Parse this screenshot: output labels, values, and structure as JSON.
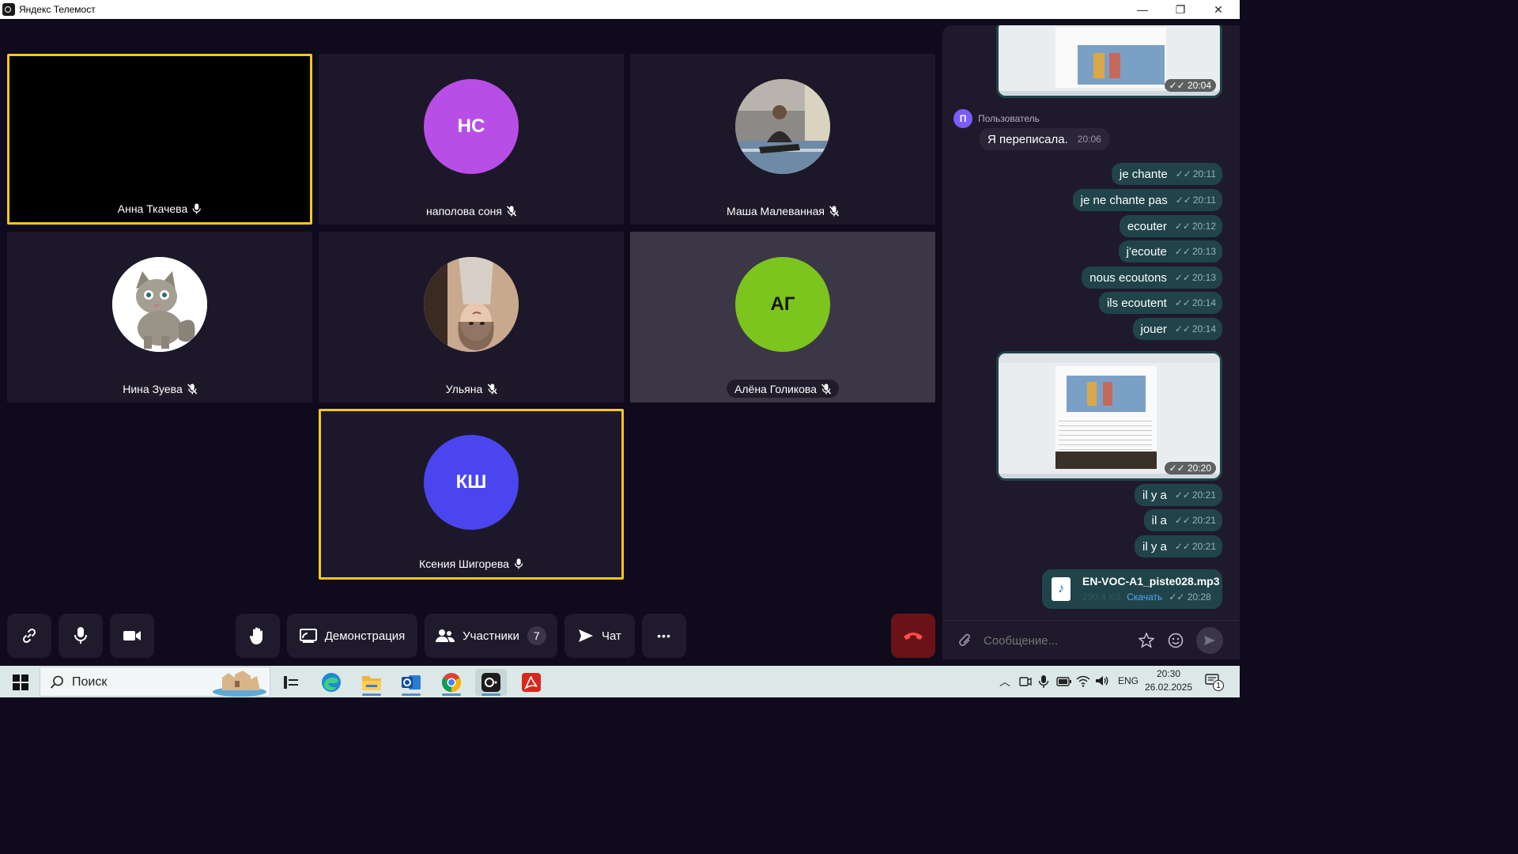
{
  "window": {
    "title": "Яндекс Телемост",
    "controls": {
      "minimize": "—",
      "maximize": "❐",
      "close": "✕"
    }
  },
  "participants": [
    {
      "name": "Анна Ткачева",
      "initials": "",
      "mic": "on",
      "avatar_color": "",
      "style": "black",
      "active": true
    },
    {
      "name": "наполова соня",
      "initials": "НС",
      "mic": "off",
      "avatar_color": "#b94ee6",
      "style": "normal",
      "active": false
    },
    {
      "name": "Маша Малеванная",
      "initials": "",
      "mic": "off",
      "avatar_color": "#8a9bab",
      "style": "normal",
      "active": false,
      "photo": true
    },
    {
      "name": "Нина Зуева",
      "initials": "",
      "mic": "off",
      "avatar_color": "#ffffff",
      "style": "normal",
      "active": false,
      "photo": true
    },
    {
      "name": "Ульяна",
      "initials": "",
      "mic": "off",
      "avatar_color": "#b89a86",
      "style": "normal",
      "active": false,
      "photo": true
    },
    {
      "name": "Алёна Голикова",
      "initials": "АГ",
      "mic": "off",
      "avatar_color": "#7cc41e",
      "style": "light",
      "active": false
    },
    {
      "name": "Ксения Шигорева",
      "initials": "КШ",
      "mic": "on",
      "avatar_color": "#4a45ee",
      "style": "normal",
      "active": true
    }
  ],
  "toolbar": {
    "link": "link-icon",
    "mic": "microphone-icon",
    "camera": "camera-icon",
    "hand": "raise-hand-icon",
    "demo_label": "Демонстрация",
    "participants_label": "Участники",
    "participants_count": "7",
    "chat_label": "Чат",
    "more": "•••",
    "end": "end-call-icon"
  },
  "chat": {
    "top_image_time": "20:04",
    "incoming": {
      "author_initial": "П",
      "author": "Пользователь",
      "text": "Я переписала.",
      "time": "20:06"
    },
    "outgoing": [
      {
        "text": "je chante",
        "time": "20:11"
      },
      {
        "text": "je ne chante pas",
        "time": "20:11"
      },
      {
        "text": "ecouter",
        "time": "20:12"
      },
      {
        "text": "j'ecoute",
        "time": "20:13"
      },
      {
        "text": "nous ecoutons",
        "time": "20:13"
      },
      {
        "text": "ils ecoutent",
        "time": "20:14"
      },
      {
        "text": "jouer",
        "time": "20:14"
      }
    ],
    "second_image_time": "20:20",
    "outgoing2": [
      {
        "text": "il y a",
        "time": "20:21"
      },
      {
        "text": "il a",
        "time": "20:21"
      },
      {
        "text": "il y a",
        "time": "20:21"
      }
    ],
    "file": {
      "name": "EN-VOC-A1_piste028.mp3",
      "size": "290.4 Kб",
      "download": "Скачать",
      "time": "20:28"
    },
    "composer_placeholder": "Сообщение..."
  },
  "taskbar": {
    "search_placeholder": "Поиск",
    "lang": "ENG",
    "time": "20:30",
    "date": "26.02.2025",
    "notifications": "1"
  }
}
